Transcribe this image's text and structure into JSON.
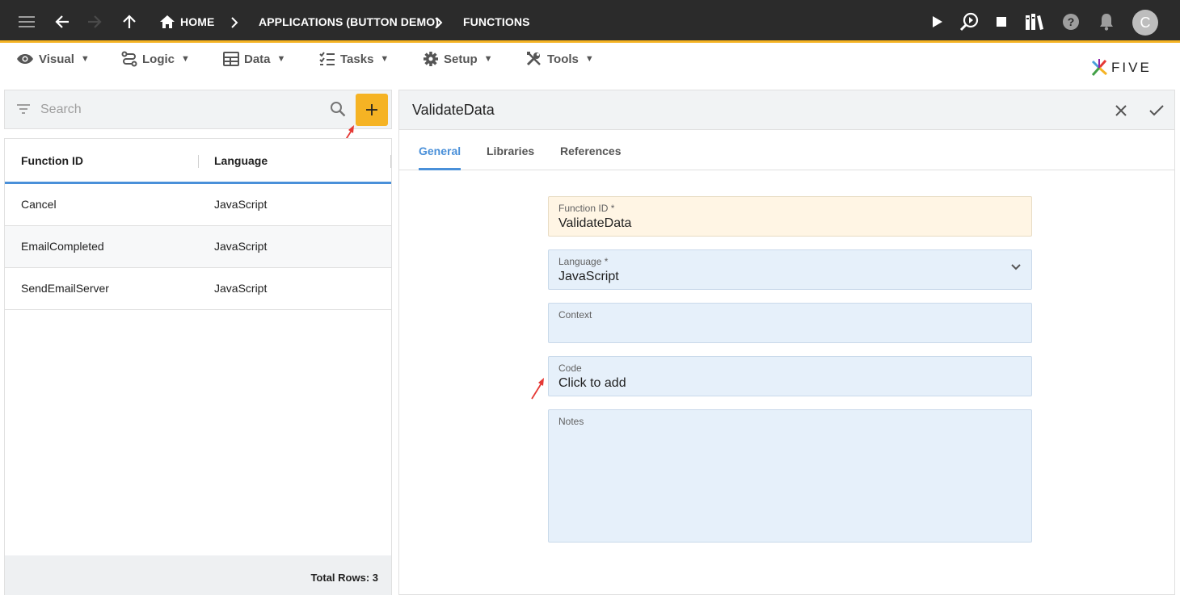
{
  "topbar": {
    "breadcrumbs": [
      "HOME",
      "APPLICATIONS (BUTTON DEMO)",
      "FUNCTIONS"
    ],
    "avatar_initial": "C",
    "icons": [
      "menu-icon",
      "back-icon",
      "forward-icon",
      "up-icon",
      "home-icon",
      "chevron-right-icon",
      "run-icon",
      "inspect-icon",
      "stop-icon",
      "library-icon",
      "help-icon",
      "notifications-icon"
    ]
  },
  "menu": {
    "items": [
      {
        "label": "Visual",
        "icon": "eye-icon"
      },
      {
        "label": "Logic",
        "icon": "logic-icon"
      },
      {
        "label": "Data",
        "icon": "table-icon"
      },
      {
        "label": "Tasks",
        "icon": "tasks-icon"
      },
      {
        "label": "Setup",
        "icon": "gear-icon"
      },
      {
        "label": "Tools",
        "icon": "tools-icon"
      }
    ],
    "caret": "▼"
  },
  "logo": {
    "text": "FIVE"
  },
  "search": {
    "placeholder": "Search"
  },
  "list": {
    "columns": [
      "Function ID",
      "Language"
    ],
    "rows": [
      {
        "id": "Cancel",
        "language": "JavaScript"
      },
      {
        "id": "EmailCompleted",
        "language": "JavaScript"
      },
      {
        "id": "SendEmailServer",
        "language": "JavaScript"
      }
    ],
    "footer": "Total Rows: 3"
  },
  "form": {
    "title": "ValidateData",
    "tabs": [
      "General",
      "Libraries",
      "References"
    ],
    "active_tab": "General",
    "fields": {
      "function_id": {
        "label": "Function ID *",
        "value": "ValidateData"
      },
      "language": {
        "label": "Language *",
        "value": "JavaScript"
      },
      "context": {
        "label": "Context",
        "value": ""
      },
      "code": {
        "label": "Code",
        "value": "Click to add"
      },
      "notes": {
        "label": "Notes",
        "value": ""
      }
    }
  },
  "colors": {
    "topbar_bg": "#2b2b2b",
    "accent_yellow": "#f5b324",
    "tab_active": "#4a90d9",
    "field_bg": "#e6f0fa",
    "field_required_bg": "#fff5e4",
    "annotation_arrow": "#e53935"
  }
}
